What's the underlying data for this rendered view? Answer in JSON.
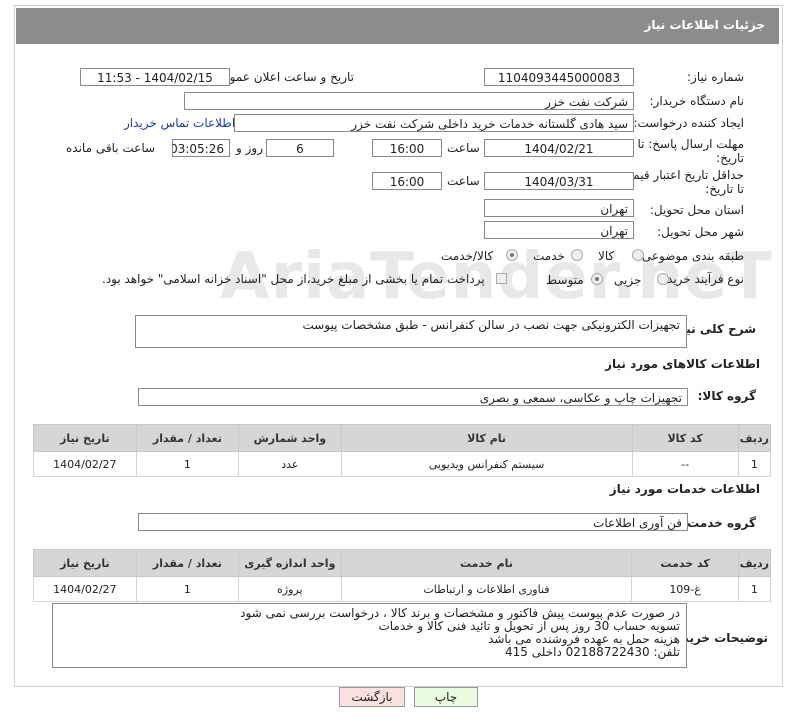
{
  "header": {
    "title": "جزئیات اطلاعات نیاز"
  },
  "fields": {
    "need_number_label": "شماره نیاز:",
    "need_number": "1104093445000083",
    "announce_label": "تاریخ و ساعت اعلان عمومی:",
    "announce_value": "1404/02/15 - 11:53",
    "buyer_org_label": "نام دستگاه خریدار:",
    "buyer_org": "شرکت نفت خزر",
    "creator_label": "ایجاد کننده درخواست:",
    "creator": "سید هادی گلستانه خدمات خرید داخلی شرکت نفت خزر",
    "contact_link": "اطلاعات تماس خریدار",
    "deadline_label_1": "مهلت ارسال پاسخ: تا",
    "deadline_label_2": "تاریخ:",
    "deadline_date": "1404/02/21",
    "time_label": "ساعت",
    "deadline_time": "16:00",
    "days_value": "6",
    "days_label": "روز و",
    "remaining_value": "03:05:26",
    "remaining_label": "ساعت باقی مانده",
    "validity_label_1": "حداقل تاریخ اعتبار قیمت:",
    "validity_label_2": "تا تاریخ:",
    "validity_date": "1404/03/31",
    "validity_time": "16:00",
    "province_label": "استان محل تحویل:",
    "province": "تهران",
    "city_label": "شهر محل تحویل:",
    "city": "تهران",
    "category_label": "طبقه بندی موضوعی:",
    "cat_goods": "کالا",
    "cat_service": "خدمت",
    "cat_both": "کالا/خدمت",
    "process_label": "نوع فرآیند خرید :",
    "proc_partial": "جزیی",
    "proc_medium": "متوسط",
    "payment_note": "پرداخت تمام یا بخشی از مبلغ خرید،از محل \"اسناد خزانه اسلامی\" خواهد بود."
  },
  "description": {
    "label": "شرح کلی نیاز:",
    "text": "تجهیزات الکترونیکی جهت نصب در سالن کنفرانس - طبق مشخصات پیوست"
  },
  "goods": {
    "section_title": "اطلاعات کالاهای مورد نیاز",
    "group_label": "گروه کالا:",
    "group_value": "تجهیزات چاپ و عکاسی، سمعی و بصری",
    "columns": [
      "ردیف",
      "کد کالا",
      "نام کالا",
      "واحد شمارش",
      "تعداد / مقدار",
      "تاریخ نیاز"
    ],
    "rows": [
      {
        "row": "1",
        "code": "--",
        "name": "سیستم کنفرانس ویدیویی",
        "unit": "عدد",
        "qty": "1",
        "date": "1404/02/27"
      }
    ]
  },
  "services": {
    "section_title": "اطلاعات خدمات مورد نیاز",
    "group_label": "گروه خدمت:",
    "group_value": "فن آوری اطلاعات",
    "columns": [
      "ردیف",
      "کد خدمت",
      "نام خدمت",
      "واحد اندازه گیری",
      "تعداد / مقدار",
      "تاریخ نیاز"
    ],
    "rows": [
      {
        "row": "1",
        "code": "غ-109",
        "name": "فناوری اطلاعات و ارتباطات",
        "unit": "پروژه",
        "qty": "1",
        "date": "1404/02/27"
      }
    ]
  },
  "buyer_notes": {
    "label": "توضیحات خریدار:",
    "lines": [
      "در صورت عدم پیوست پیش فاکتور و مشخصات و برند کالا ، درخواست بررسی نمی شود",
      "تسویه حساب 30 روز پس از تحویل و تائید فنی کالا و خدمات",
      "هزینه حمل به عهده فروشنده می باشد",
      "تلفن: 02188722430 داخلی 415"
    ]
  },
  "buttons": {
    "print": "چاپ",
    "back": "بازگشت"
  },
  "watermark": "AriaTender.neT",
  "colors": {
    "title_bg": "#8c8c8c",
    "print_bg": "#eafce0",
    "back_bg": "#fbe0e0",
    "table_header": "#d6d6d6",
    "link": "#1c3fa0"
  }
}
